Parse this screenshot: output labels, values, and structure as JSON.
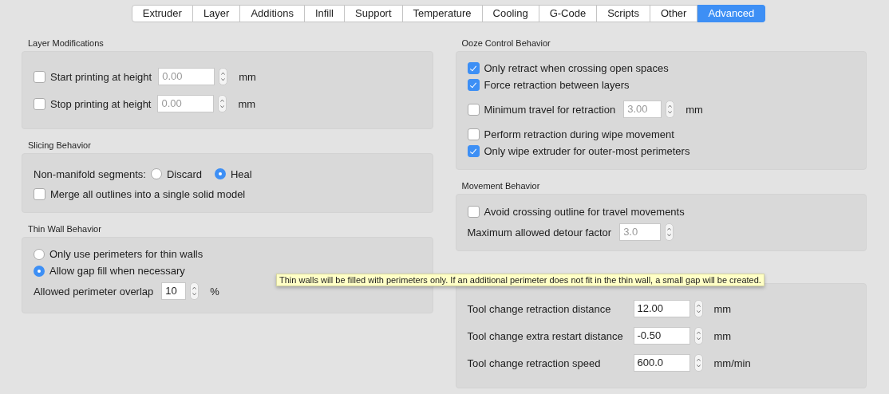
{
  "tabs": [
    {
      "label": "Extruder",
      "selected": false
    },
    {
      "label": "Layer",
      "selected": false
    },
    {
      "label": "Additions",
      "selected": false
    },
    {
      "label": "Infill",
      "selected": false
    },
    {
      "label": "Support",
      "selected": false
    },
    {
      "label": "Temperature",
      "selected": false
    },
    {
      "label": "Cooling",
      "selected": false
    },
    {
      "label": "G-Code",
      "selected": false
    },
    {
      "label": "Scripts",
      "selected": false
    },
    {
      "label": "Other",
      "selected": false
    },
    {
      "label": "Advanced",
      "selected": true
    }
  ],
  "columns": [
    {
      "groups": [
        {
          "title": "Layer Modifications",
          "rows": [
            {
              "kind": "checkbox_field",
              "label": "Start printing at height",
              "checked": false,
              "value": "0.00",
              "disabled": true,
              "unit": "mm"
            },
            {
              "kind": "checkbox_field",
              "label": "Stop printing at height",
              "checked": false,
              "value": "0.00",
              "disabled": true,
              "unit": "mm"
            }
          ]
        },
        {
          "title": "Slicing Behavior",
          "rows": [
            {
              "kind": "radio_group",
              "label": "Non-manifold segments:",
              "options": [
                {
                  "label": "Discard",
                  "selected": false
                },
                {
                  "label": "Heal",
                  "selected": true
                }
              ]
            },
            {
              "kind": "checkbox",
              "label": "Merge all outlines into a single solid model",
              "checked": false
            }
          ]
        },
        {
          "title": "Thin Wall Behavior",
          "rows": [
            {
              "kind": "radio",
              "label": "Only use perimeters for thin walls",
              "selected": false
            },
            {
              "kind": "radio",
              "label": "Allow gap fill when necessary",
              "selected": true
            },
            {
              "kind": "field",
              "label": "Allowed perimeter overlap",
              "value": "10",
              "disabled": false,
              "unit": "%"
            }
          ]
        }
      ]
    },
    {
      "groups": [
        {
          "title": "Ooze Control Behavior",
          "rows": [
            {
              "kind": "checkbox",
              "label": "Only retract when crossing open spaces",
              "checked": true
            },
            {
              "kind": "checkbox",
              "label": "Force retraction between layers",
              "checked": true
            },
            {
              "kind": "checkbox_field",
              "label": "Minimum travel for retraction",
              "checked": false,
              "value": "3.00",
              "disabled": true,
              "unit": "mm"
            },
            {
              "kind": "checkbox",
              "label": "Perform retraction during wipe movement",
              "checked": false
            },
            {
              "kind": "checkbox",
              "label": "Only wipe extruder for outer-most perimeters",
              "checked": true
            }
          ]
        },
        {
          "title": "Movement Behavior",
          "rows": [
            {
              "kind": "checkbox",
              "label": "Avoid crossing outline for travel movements",
              "checked": false
            },
            {
              "kind": "field",
              "label": "Maximum allowed detour factor",
              "value": "3.0",
              "disabled": true
            }
          ]
        },
        {
          "rows": [
            {
              "kind": "field",
              "label": "Tool change retraction distance",
              "value": "12.00",
              "disabled": false,
              "unit": "mm"
            },
            {
              "kind": "field",
              "label": "Tool change extra restart distance",
              "value": "-0.50",
              "disabled": false,
              "unit": "mm"
            },
            {
              "kind": "field",
              "label": "Tool change retraction speed",
              "value": "600.0",
              "disabled": false,
              "unit": "mm/min"
            }
          ]
        }
      ]
    }
  ],
  "tooltip": "Thin walls will be filled with perimeters only.  If an additional perimeter does not fit in the thin wall, a small gap will be created."
}
